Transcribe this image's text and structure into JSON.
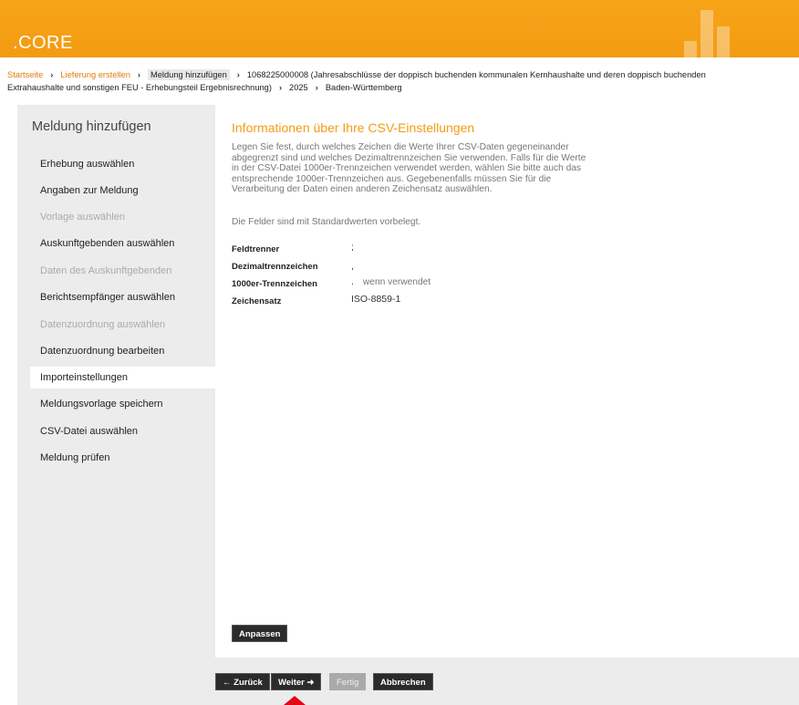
{
  "app": {
    "logo": ".CORE"
  },
  "breadcrumb": {
    "items": [
      "Startseite",
      "Lieferung erstellen"
    ],
    "current": "Meldung hinzufügen",
    "rest_1": "1068225000008 (Jahresabschlüsse der doppisch buchenden kommunalen Kernhaushalte und deren doppisch buchenden",
    "rest_2": "Extrahaushalte und sonstigen FEU - Erhebungsteil Ergebnisrechnung)",
    "year": "2025",
    "state": "Baden-Württemberg",
    "separator": "›"
  },
  "sidebar": {
    "title": "Meldung hinzufügen",
    "items": [
      {
        "label": "Erhebung auswählen",
        "state": "enabled"
      },
      {
        "label": "Angaben zur Meldung",
        "state": "enabled"
      },
      {
        "label": "Vorlage auswählen",
        "state": "disabled"
      },
      {
        "label": "Auskunftgebenden auswählen",
        "state": "enabled"
      },
      {
        "label": "Daten des Auskunftgebenden",
        "state": "disabled"
      },
      {
        "label": "Berichtsempfänger auswählen",
        "state": "enabled"
      },
      {
        "label": "Datenzuordnung auswählen",
        "state": "disabled"
      },
      {
        "label": "Datenzuordnung bearbeiten",
        "state": "enabled"
      },
      {
        "label": "Importeinstellungen",
        "state": "active"
      },
      {
        "label": "Meldungsvorlage speichern",
        "state": "enabled"
      },
      {
        "label": "CSV-Datei auswählen",
        "state": "enabled"
      },
      {
        "label": "Meldung prüfen",
        "state": "enabled"
      }
    ]
  },
  "main": {
    "title": "Informationen über Ihre CSV-Einstellungen",
    "desc_lines": [
      "Legen Sie fest, durch welches Zeichen die Werte Ihrer CSV-Daten gegeneinander",
      "abgegrenzt sind und welches Dezimaltrennzeichen Sie verwenden. Falls für die Werte",
      "in der CSV-Datei 1000er-Trennzeichen verwendet werden, wählen Sie bitte auch das",
      "entsprechende 1000er-Trennzeichen aus. Gegebenenfalls müssen Sie für die",
      "Verarbeitung der Daten einen anderen Zeichensatz auswählen."
    ],
    "note": "Die Felder sind mit Standardwerten vorbelegt.",
    "fields": [
      {
        "label": "Feldtrenner",
        "value": ";",
        "hint": ""
      },
      {
        "label": "Dezimaltrennzeichen",
        "value": ",",
        "hint": ""
      },
      {
        "label": "1000er-Trennzeichen",
        "value": ".",
        "hint": "wenn verwendet"
      },
      {
        "label": "Zeichensatz",
        "value": "ISO-8859-1",
        "hint": ""
      }
    ],
    "adjust_button": "Anpassen"
  },
  "footer": {
    "back": "← Zurück",
    "next": "Weiter ➜",
    "finish": "Fertig",
    "cancel": "Abbrechen"
  },
  "colors": {
    "brand": "#f39b12",
    "link": "#e37a06",
    "pointer": "#e30613"
  }
}
